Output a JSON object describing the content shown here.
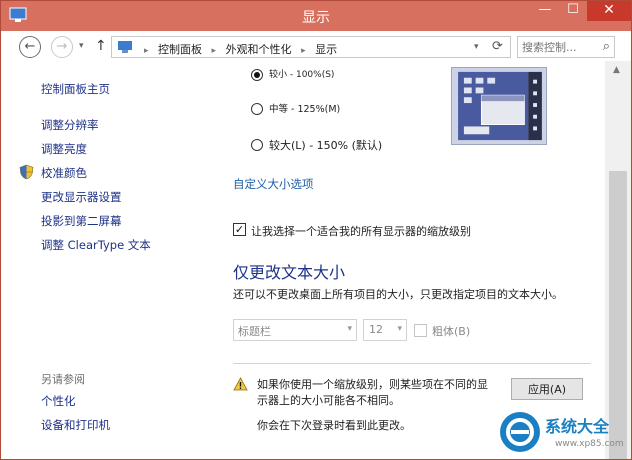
{
  "window": {
    "title": "显示",
    "minimize_glyph": "—",
    "maximize_glyph": "☐",
    "close_glyph": "✕"
  },
  "navigation": {
    "back_glyph": "←",
    "forward_glyph": "→",
    "up_glyph": "↑",
    "breadcrumbs": [
      "控制面板",
      "外观和个性化",
      "显示"
    ],
    "search_placeholder": "搜索控制..."
  },
  "sidebar": {
    "home": "控制面板主页",
    "items": [
      {
        "label": "调整分辨率"
      },
      {
        "label": "调整亮度"
      },
      {
        "label": "校准颜色"
      },
      {
        "label": "更改显示器设置"
      },
      {
        "label": "投影到第二屏幕"
      },
      {
        "label": "调整 ClearType 文本"
      }
    ],
    "see_also_heading": "另请参阅",
    "see_also": [
      {
        "label": "个性化"
      },
      {
        "label": "设备和打印机"
      }
    ]
  },
  "main": {
    "scale_options": [
      {
        "label": "较小 - 100%(S)",
        "selected": true
      },
      {
        "label": "中等 - 125%(M)",
        "selected": false
      },
      {
        "label": "较大(L) - 150% (默认)",
        "selected": false
      }
    ],
    "custom_size_link": "自定义大小选项",
    "single_scale_checkbox": {
      "label": "让我选择一个适合我的所有显示器的缩放级别",
      "checked": true
    },
    "text_size_heading": "仅更改文本大小",
    "text_size_description": "还可以不更改桌面上所有项目的大小，只更改指定项目的文本大小。",
    "item_select": {
      "value": "标题栏"
    },
    "size_select": {
      "value": "12"
    },
    "bold_checkbox": {
      "label": "粗体(B)",
      "checked": false
    },
    "warning_text": "如果你使用一个缩放级别，则某些项在不同的显示器上的大小可能各不相同。",
    "apply_button": "应用(A)",
    "relogin_note": "你会在下次登录时看到此更改。"
  },
  "watermark": {
    "text": "系统大全",
    "subtext": "www.xp85.com"
  },
  "colors": {
    "titlebar": "#d8705f",
    "close_button": "#c8392b",
    "link": "#1e3287",
    "heading": "#1e3287",
    "custom_link": "#1e5fa8",
    "watermark": "#1b7fc4"
  },
  "icons": {
    "app": "control-panel-icon",
    "shield": "uac-shield-icon",
    "warning": "warning-icon",
    "search": "search-icon",
    "refresh": "refresh-icon"
  }
}
